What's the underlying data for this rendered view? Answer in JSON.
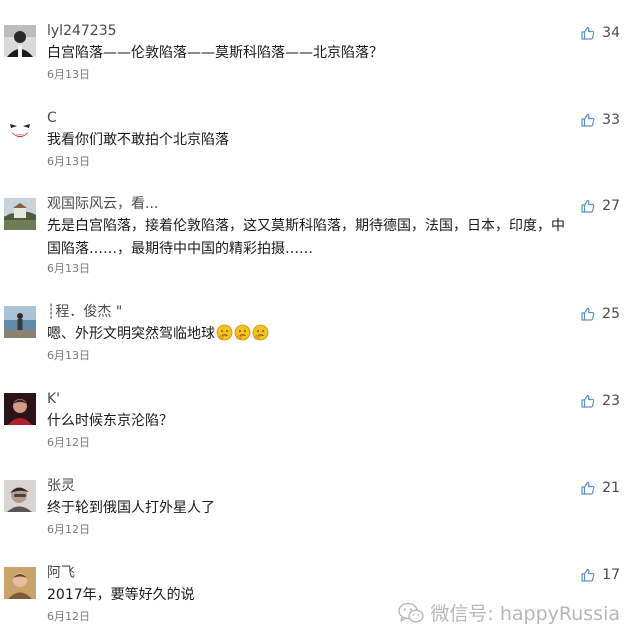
{
  "comments": [
    {
      "username": "lyl247235",
      "content": "白宫陷落——伦敦陷落——莫斯科陷落——北京陷落？",
      "date": "6月13日",
      "likes": "34",
      "avatar_icon": "man-in-suit-photo-icon"
    },
    {
      "username": "C",
      "content": "我看你们敢不敢拍个北京陷落",
      "date": "6月13日",
      "likes": "33",
      "avatar_icon": "joker-face-icon"
    },
    {
      "username": "观国际风云，看...",
      "content": "先是白宫陷落，接着伦敦陷落，这又莫斯科陷落，期待德国，法国，日本，印度，中国陷落……，最期待中中国的精彩拍摄……",
      "date": "6月13日",
      "likes": "27",
      "avatar_icon": "landscape-photo-icon"
    },
    {
      "username": "┊程．俊杰 \"",
      "content": "嗯、外形文明突然驾临地球",
      "date": "6月13日",
      "likes": "25",
      "avatar_icon": "person-by-sea-photo-icon",
      "emoji_count": 3,
      "emoji_icon": "thinking-face-emoji"
    },
    {
      "username": "K'",
      "content": "什么时候东京沦陷？",
      "date": "6月12日",
      "likes": "23",
      "avatar_icon": "red-portrait-photo-icon"
    },
    {
      "username": "张灵",
      "content": "终于轮到俄国人打外星人了",
      "date": "6月12日",
      "likes": "21",
      "avatar_icon": "grey-portrait-photo-icon"
    },
    {
      "username": "阿飞",
      "content": "2017年，要等好久的说",
      "date": "6月12日",
      "likes": "17",
      "avatar_icon": "warm-portrait-photo-icon"
    }
  ],
  "watermark": {
    "text": "微信号: happyRussia",
    "icon": "wechat-logo-icon"
  },
  "colors": {
    "like_icon": "#5b8fd6",
    "username": "#4a4a4a",
    "content": "#1a1a1a",
    "date": "#7a7a7a",
    "watermark": "#b7b7b7"
  }
}
